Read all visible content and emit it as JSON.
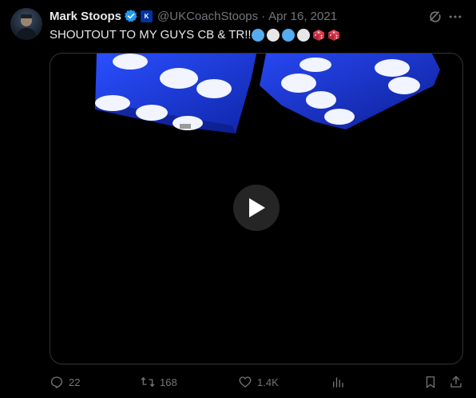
{
  "author": {
    "name": "Mark Stoops",
    "handle": "@UKCoachStoops",
    "separator": "·",
    "date": "Apr 16, 2021",
    "verified": true,
    "affiliation_badge": "K"
  },
  "post": {
    "text": "SHOUTOUT TO MY GUYS CB & TR!!",
    "emoji_circles": [
      "blue",
      "white",
      "blue",
      "white"
    ],
    "emoji_dice_count": 2
  },
  "media": {
    "type": "video",
    "play_icon": "play-icon"
  },
  "actions": {
    "replies": "22",
    "reposts": "168",
    "likes": "1.4K",
    "views_icon": "analytics-icon",
    "bookmark_icon": "bookmark-icon",
    "share_icon": "share-icon"
  },
  "colors": {
    "background": "#000000",
    "text": "#e7e9ea",
    "muted": "#71767b",
    "verified_blue": "#1d9bf0",
    "dice_blue": "#1f3fd6",
    "border": "#2f3336"
  }
}
